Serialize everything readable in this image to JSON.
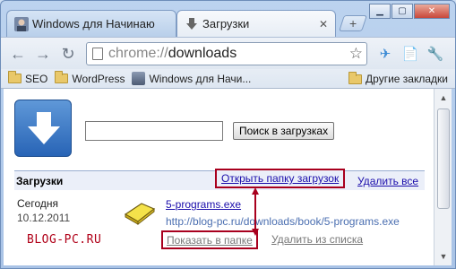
{
  "tabs": [
    {
      "title": "Windows для Начинаю",
      "active": false
    },
    {
      "title": "Загрузки",
      "active": true
    }
  ],
  "address": {
    "scheme": "chrome://",
    "path": "downloads"
  },
  "bookmarks": {
    "items": [
      "SEO",
      "WordPress",
      "Windows для Начи..."
    ],
    "other": "Другие закладки"
  },
  "downloads": {
    "search_button": "Поиск в загрузках",
    "search_value": "",
    "header_title": "Загрузки",
    "open_folder": "Открыть папку загрузок",
    "delete_all": "Удалить все",
    "entry": {
      "date_label": "Сегодня",
      "date": "10.12.2011",
      "file_name": "5-programs.exe",
      "url": "http://blog-pc.ru/downloads/book/5-programs.exe",
      "show_in_folder": "Показать в папке",
      "remove_from_list": "Удалить из списка"
    }
  },
  "watermark": "BLOG-PC.RU",
  "colors": {
    "highlight_box": "#a8001e",
    "link": "#1a0dab",
    "header_bg": "#ebeff9"
  }
}
